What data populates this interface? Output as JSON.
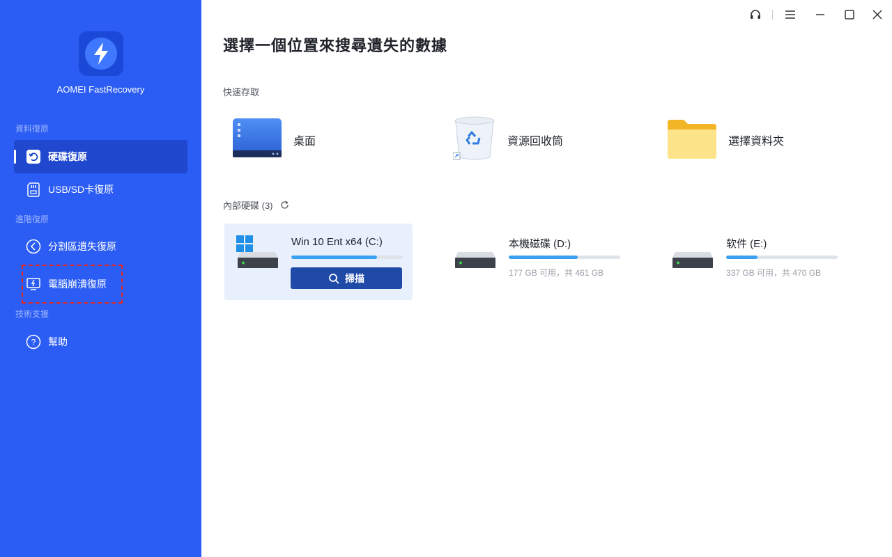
{
  "app": {
    "name": "AOMEI FastRecovery"
  },
  "sidebar": {
    "sections": [
      {
        "title": "資料復原"
      },
      {
        "title": "進階復原"
      },
      {
        "title": "技術支援"
      }
    ],
    "items": [
      {
        "label": "硬碟復原",
        "icon": "hard-disk-restore-icon",
        "active": true
      },
      {
        "label": "USB/SD卡復原",
        "icon": "sd-card-icon",
        "active": false
      },
      {
        "label": "分割區遺失復原",
        "icon": "partition-icon",
        "active": false
      },
      {
        "label": "電腦崩潰復原",
        "icon": "monitor-crash-icon",
        "active": false
      },
      {
        "label": "幫助",
        "icon": "help-icon",
        "active": false
      }
    ]
  },
  "window_controls": [
    "headset-icon",
    "menu-icon",
    "minimize-icon",
    "maximize-icon",
    "close-icon"
  ],
  "main": {
    "title": "選擇一個位置來搜尋遺失的數據",
    "quick_access_title": "快速存取",
    "quick_access": [
      {
        "label": "桌面",
        "icon": "desktop-icon"
      },
      {
        "label": "資源回收筒",
        "icon": "recycle-bin-icon"
      },
      {
        "label": "選擇資料夾",
        "icon": "folder-icon"
      }
    ],
    "drives_title": "內部硬碟 (3)",
    "drives": [
      {
        "name": "Win 10 Ent x64 (C:)",
        "used_fraction": 0.77,
        "info": "",
        "selected": true,
        "scan_label": "掃描"
      },
      {
        "name": "本機磁碟 (D:)",
        "used_fraction": 0.62,
        "info": "177 GB 可用，共 461 GB",
        "selected": false
      },
      {
        "name": "软件 (E:)",
        "used_fraction": 0.28,
        "info": "337 GB 可用，共 470 GB",
        "selected": false
      }
    ]
  },
  "colors": {
    "sidebar": "#2b5cf3",
    "accent": "#1f4aa8",
    "progress": "#3aa0f0",
    "highlight": "#e0261e"
  }
}
